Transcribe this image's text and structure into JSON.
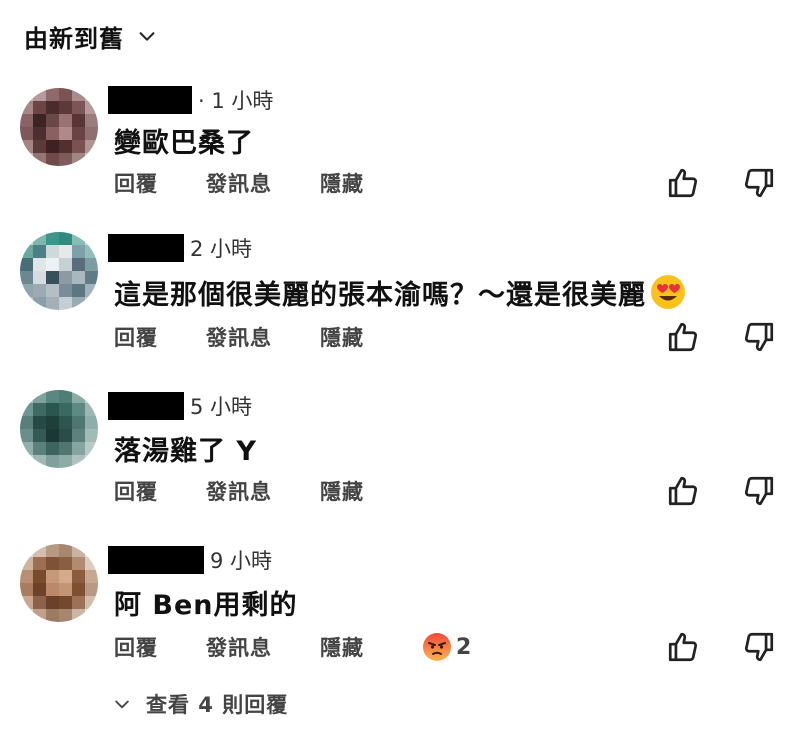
{
  "sort": {
    "label": "由新到舊"
  },
  "actions": {
    "reply": "回覆",
    "message": "發訊息",
    "hide": "隱藏"
  },
  "comments": [
    {
      "time": "· 1 小時",
      "text": "變歐巴桑了"
    },
    {
      "time": "2 小時",
      "text": "這是那個很美麗的張本渝嗎？～還是很美麗",
      "emoji": "heart-eyes"
    },
    {
      "time": "5 小時",
      "text": "落湯雞了 Y"
    },
    {
      "time": "9 小時",
      "text": "阿 Ben用剩的",
      "reaction": {
        "emoji": "angry",
        "count": "2"
      }
    }
  ],
  "view_replies": {
    "label": "查看 4 則回覆"
  },
  "colors": {
    "text": "#111111",
    "secondary": "#444444",
    "redaction": "#000000",
    "background": "#ffffff"
  }
}
